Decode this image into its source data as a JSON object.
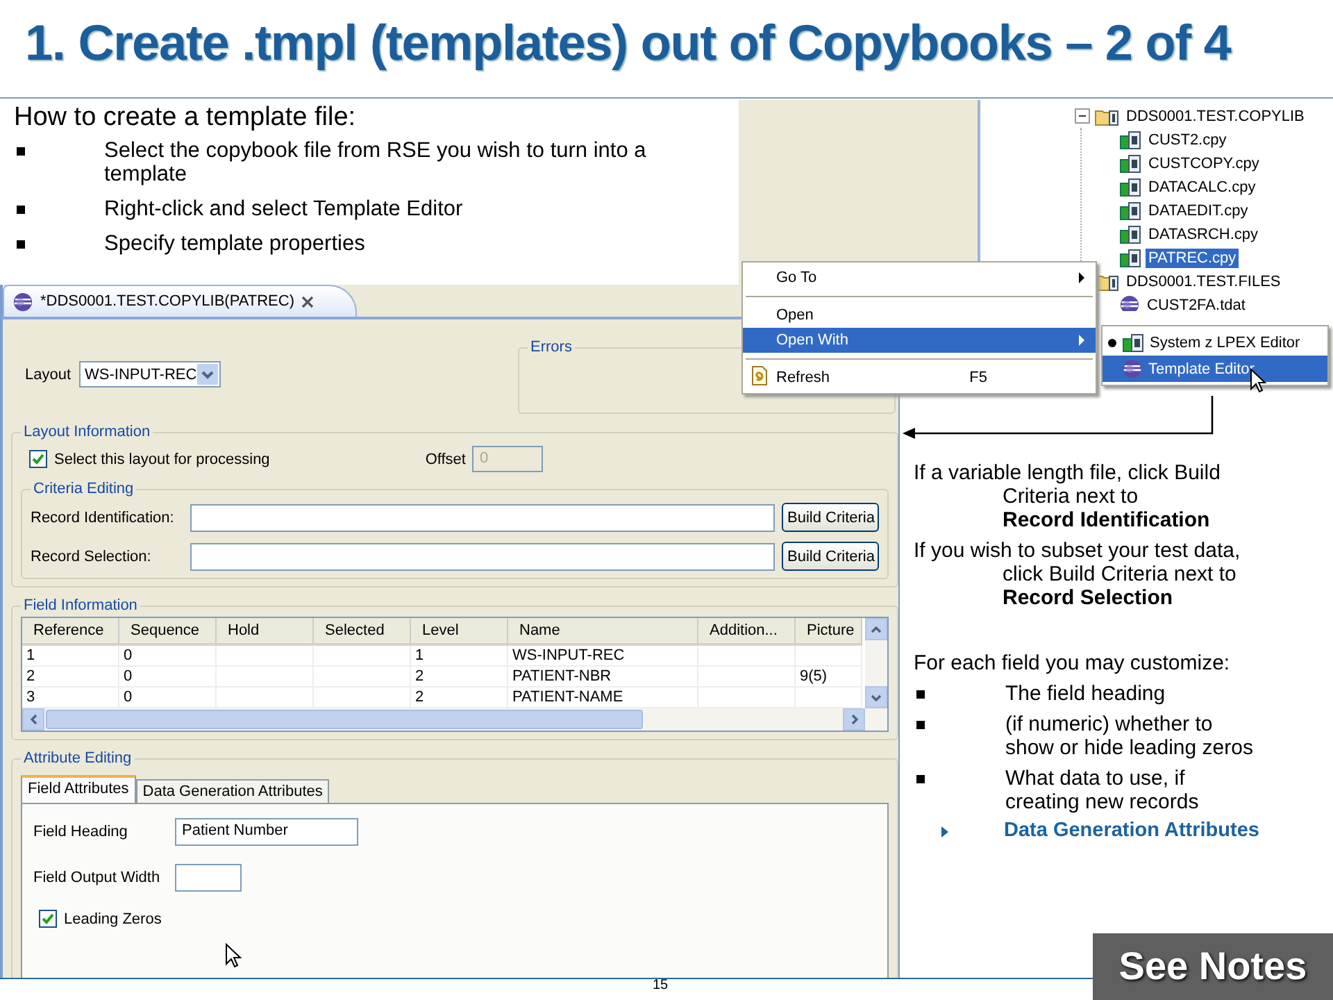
{
  "title": "1. Create .tmpl (templates) out of Copybooks – 2 of 4",
  "intro": {
    "heading": "How to create a template file:",
    "bullets": [
      "Select the copybook file from RSE you wish to turn into a template",
      "Right-click and select Template Editor",
      "Specify template properties"
    ]
  },
  "tree": {
    "items": [
      {
        "label": "DDS0001.TEST.COPYLIB",
        "expanded": true,
        "children": [
          {
            "label": "CUST2.cpy",
            "kind": "copybook",
            "selected": false
          },
          {
            "label": "CUSTCOPY.cpy",
            "kind": "copybook",
            "selected": false
          },
          {
            "label": "DATACALC.cpy",
            "kind": "copybook",
            "selected": false
          },
          {
            "label": "DATAEDIT.cpy",
            "kind": "copybook",
            "selected": false
          },
          {
            "label": "DATASRCH.cpy",
            "kind": "copybook",
            "selected": false
          },
          {
            "label": "PATREC.cpy",
            "kind": "copybook",
            "selected": true
          }
        ]
      },
      {
        "label": "DDS0001.TEST.FILES",
        "children": [
          {
            "label": "CUST2FA.tdat",
            "kind": "data",
            "selected": false
          }
        ]
      }
    ]
  },
  "context_menu": {
    "items": [
      {
        "kind": "item",
        "label": "Go To",
        "submenu": true,
        "selected": false
      },
      {
        "kind": "separator"
      },
      {
        "kind": "item",
        "label": "Open",
        "submenu": false,
        "selected": false
      },
      {
        "kind": "item",
        "label": "Open With",
        "submenu": true,
        "selected": true
      },
      {
        "kind": "separator"
      },
      {
        "kind": "item-icon",
        "label": "Refresh",
        "shortcut": "F5",
        "submenu": false,
        "selected": false
      }
    ]
  },
  "submenu": {
    "items": [
      {
        "label": "System z LPEX Editor",
        "kind": "lpex",
        "default": true,
        "selected": false
      },
      {
        "label": "Template Editor",
        "kind": "template",
        "default": false,
        "selected": true
      }
    ]
  },
  "editor": {
    "tab": {
      "title": "*DDS0001.TEST.COPYLIB(PATREC)"
    },
    "layout": {
      "label": "Layout",
      "value": "WS-INPUT-REC"
    },
    "errors": {
      "title": "Errors"
    },
    "layout_information": {
      "title": "Layout Information",
      "select": {
        "label": "Select this layout for processing",
        "checked": true
      },
      "offset": {
        "label": "Offset",
        "value": "0",
        "disabled": true
      }
    },
    "criteria_editing": {
      "title": "Criteria Editing",
      "rows": [
        {
          "label": "Record Identification:",
          "button": "Build Criteria"
        },
        {
          "label": "Record Selection:",
          "button": "Build Criteria"
        }
      ]
    },
    "field_information": {
      "title": "Field Information",
      "table": {
        "columns": [
          "Reference",
          "Sequence",
          "Hold",
          "Selected",
          "Level",
          "Name",
          "Addition...",
          "Picture"
        ],
        "rows": [
          [
            "1",
            "0",
            null,
            null,
            "1",
            "WS-INPUT-REC",
            null,
            null
          ],
          [
            "2",
            "0",
            null,
            null,
            "2",
            "PATIENT-NBR",
            null,
            "9(5)"
          ],
          [
            "3",
            "0",
            null,
            null,
            "2",
            "PATIENT-NAME",
            null,
            null
          ]
        ]
      }
    },
    "attribute_editing": {
      "title": "Attribute Editing",
      "tabs": [
        {
          "label": "Field Attributes",
          "selected": true
        },
        {
          "label": "Data Generation Attributes",
          "selected": false
        }
      ],
      "fields": [
        {
          "label": "Field Heading",
          "value": "Patient Number"
        },
        {
          "label": "Field Output Width"
        }
      ],
      "leading_zeros": {
        "label": "Leading Zeros",
        "checked": true
      }
    }
  },
  "notes": {
    "paragraphs": [
      "If a variable length file, click Build\nCriteria next to\n**Record Identification**",
      "If you wish to subset your test data,\nclick Build Criteria next to\n**Record Selection**"
    ],
    "customize": {
      "heading": "For each field you may customize:",
      "bullets": [
        "The field heading",
        "(if numeric) whether to\nshow or hide leading zeros",
        "What data to use, if\ncreating new records"
      ],
      "sub_bullet": "Data Generation Attributes"
    }
  },
  "footer": {
    "page": "15",
    "badge": "See Notes"
  }
}
